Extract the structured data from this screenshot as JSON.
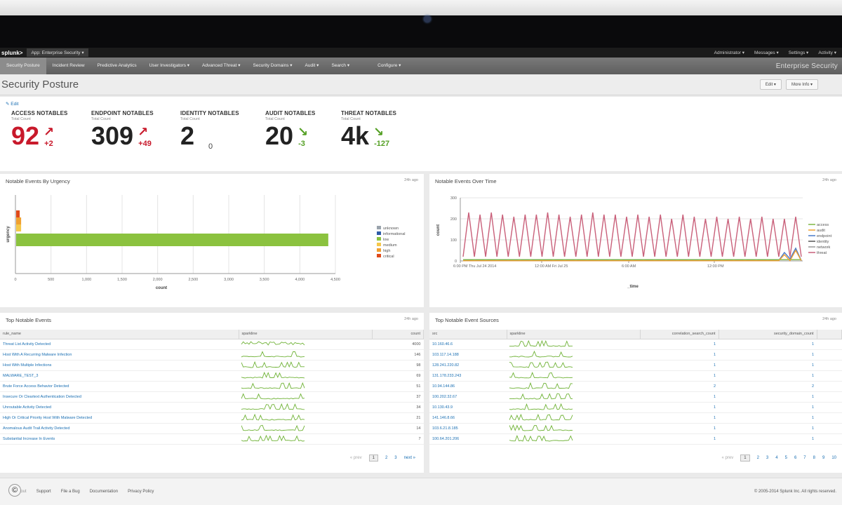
{
  "app": {
    "logo": "splunk>",
    "app_switcher": "App: Enterprise Security",
    "top_links": [
      "Administrator",
      "Messages",
      "Settings",
      "Activity"
    ]
  },
  "nav": {
    "items": [
      "Security Posture",
      "Incident Review",
      "Predictive Analytics",
      "User Investigators",
      "Advanced Threat",
      "Security Domains",
      "Audit",
      "Search",
      "Configure"
    ],
    "brand": "Enterprise Security"
  },
  "header": {
    "title": "Security Posture",
    "edit_btn": "Edit",
    "more_btn": "More Info"
  },
  "kpis": {
    "edit": "Edit",
    "items": [
      {
        "label": "ACCESS NOTABLES",
        "sub": "Total Count",
        "value": "92",
        "arrow": "↗",
        "delta": "+2"
      },
      {
        "label": "ENDPOINT NOTABLES",
        "sub": "Total Count",
        "value": "309",
        "arrow": "↗",
        "delta": "+49"
      },
      {
        "label": "IDENTITY NOTABLES",
        "sub": "Total Count",
        "value": "2",
        "arrow": "",
        "delta": "0"
      },
      {
        "label": "AUDIT NOTABLES",
        "sub": "Total Count",
        "value": "20",
        "arrow": "↘",
        "delta": "-3"
      },
      {
        "label": "THREAT NOTABLES",
        "sub": "Total Count",
        "value": "4k",
        "arrow": "↘",
        "delta": "-127"
      }
    ]
  },
  "panels": {
    "urgency_title": "Notable Events By Urgency",
    "over_time_title": "Notable Events Over Time",
    "top_events_title": "Top Notable Events",
    "top_sources_title": "Top Notable Event Sources",
    "link": "24h ago"
  },
  "chart_data": [
    {
      "type": "bar",
      "orientation": "horizontal",
      "stacked": true,
      "title": "Notable Events By Urgency",
      "xlabel": "count",
      "ylabel": "urgency",
      "xlim": [
        0,
        4500
      ],
      "xticks": [
        "0",
        "500",
        "1,000",
        "1,500",
        "2,000",
        "2,500",
        "3,000",
        "3,500",
        "4,000",
        "4,500"
      ],
      "legend": [
        "unknown",
        "informational",
        "low",
        "medium",
        "high",
        "critical"
      ],
      "legend_position": "right",
      "colors": {
        "unknown": "#9aa3ad",
        "informational": "#2e5ca8",
        "low": "#8bc23f",
        "medium": "#f5c84a",
        "high": "#f0a030",
        "critical": "#e04a1a"
      },
      "bars": [
        {
          "category": "critical",
          "value": 60
        },
        {
          "category": "high",
          "value": 80
        },
        {
          "category": "medium",
          "value": 80
        },
        {
          "category": "low",
          "value": 4400
        }
      ],
      "grid": true
    },
    {
      "type": "line",
      "title": "Notable Events Over Time",
      "xlabel": "_time",
      "ylabel": "count",
      "ylim": [
        0,
        300
      ],
      "yticks": [
        "0",
        "100",
        "200",
        "300"
      ],
      "xticks": [
        "6:00 PM Thu Jul 24 2014",
        "12:00 AM Fri Jul 25",
        "6:00 AM",
        "12:00 PM"
      ],
      "legend": [
        "access",
        "audit",
        "endpoint",
        "identity",
        "network",
        "threat"
      ],
      "legend_position": "right",
      "series": [
        {
          "name": "threat",
          "color": "#c9607a",
          "values": [
            20,
            230,
            20,
            220,
            20,
            230,
            20,
            220,
            20,
            210,
            20,
            220,
            20,
            220,
            20,
            230,
            20,
            220,
            20,
            210,
            20,
            220,
            20,
            230,
            20,
            220,
            20,
            220,
            20,
            210,
            20,
            220,
            20,
            210,
            20,
            220,
            20,
            200,
            20,
            220,
            20,
            210,
            20,
            200,
            20,
            210,
            20,
            200,
            20,
            210,
            20,
            200,
            20,
            210,
            20,
            200,
            20,
            200,
            20,
            210,
            20
          ]
        },
        {
          "name": "endpoint",
          "color": "#4a7ac8",
          "values": [
            2,
            4,
            2,
            4,
            2,
            4,
            2,
            4,
            2,
            4,
            2,
            4,
            2,
            4,
            2,
            4,
            2,
            4,
            2,
            4,
            2,
            4,
            2,
            4,
            2,
            4,
            2,
            4,
            2,
            4,
            2,
            4,
            2,
            4,
            2,
            4,
            2,
            4,
            2,
            4,
            2,
            4,
            2,
            4,
            2,
            4,
            2,
            4,
            2,
            4,
            2,
            4,
            2,
            4,
            2,
            4,
            2,
            40,
            10,
            60,
            2
          ]
        },
        {
          "name": "access",
          "color": "#7fb744",
          "values": [
            6,
            6,
            6,
            6,
            6,
            6,
            6,
            6,
            6,
            6,
            6,
            6,
            6,
            6,
            6,
            6,
            6,
            6,
            6,
            6,
            6,
            6,
            6,
            6,
            6,
            6,
            6,
            6,
            6,
            6,
            6,
            6,
            6,
            6,
            6,
            6,
            6,
            6,
            6,
            6,
            6,
            6,
            6,
            6,
            6,
            6,
            6,
            6,
            6,
            6,
            6,
            6,
            6,
            6,
            6,
            6,
            6,
            6,
            6,
            6,
            6
          ]
        },
        {
          "name": "audit",
          "color": "#f0a030",
          "values": [
            1,
            1,
            1,
            1,
            1,
            1,
            1,
            1,
            1,
            1,
            1,
            1,
            1,
            1,
            1,
            1,
            1,
            1,
            1,
            1,
            1,
            1,
            1,
            1,
            1,
            1,
            1,
            1,
            1,
            1,
            1,
            1,
            1,
            1,
            1,
            1,
            1,
            1,
            1,
            1,
            1,
            1,
            1,
            1,
            1,
            1,
            1,
            1,
            1,
            1,
            1,
            1,
            1,
            1,
            1,
            1,
            1,
            30,
            1,
            50,
            1
          ]
        }
      ],
      "grid": true
    }
  ],
  "top_events": {
    "columns": [
      "rule_name",
      "sparkline",
      "count"
    ],
    "rows": [
      {
        "name": "Threat List Activity Detected",
        "count": "4000"
      },
      {
        "name": "Host With A Recurring Malware Infection",
        "count": "146"
      },
      {
        "name": "Host With Multiple Infections",
        "count": "98"
      },
      {
        "name": "MALWARE_TEST_3",
        "count": "69"
      },
      {
        "name": "Brute Force Access Behavior Detected",
        "count": "51"
      },
      {
        "name": "Insecure Or Cleartext Authentication Detected",
        "count": "37"
      },
      {
        "name": "Unroutable Activity Detected",
        "count": "34"
      },
      {
        "name": "High Or Critical Priority Host With Malware Detected",
        "count": "21"
      },
      {
        "name": "Anomalous Audit Trail Activity Detected",
        "count": "14"
      },
      {
        "name": "Substantial Increase In Events",
        "count": "7"
      }
    ],
    "pager": [
      "« prev",
      "1",
      "2",
      "3",
      "next »"
    ]
  },
  "top_sources": {
    "columns": [
      "src",
      "sparkline",
      "correlation_search_count",
      "security_domain_count",
      ""
    ],
    "rows": [
      {
        "src": "10.160.46.6",
        "csc": "1",
        "sdc": "1"
      },
      {
        "src": "103.117.14.188",
        "csc": "1",
        "sdc": "1"
      },
      {
        "src": "128.241.220.82",
        "csc": "1",
        "sdc": "1"
      },
      {
        "src": "131.178.233.243",
        "csc": "1",
        "sdc": "1"
      },
      {
        "src": "10.94.144.86",
        "csc": "2",
        "sdc": "2"
      },
      {
        "src": "100.202.32.67",
        "csc": "1",
        "sdc": "1"
      },
      {
        "src": "10.130.43.9",
        "csc": "1",
        "sdc": "1"
      },
      {
        "src": "141.146.8.66",
        "csc": "1",
        "sdc": "1"
      },
      {
        "src": "103.6.21.8.185",
        "csc": "1",
        "sdc": "1"
      },
      {
        "src": "100.64.201.206",
        "csc": "1",
        "sdc": "1"
      }
    ],
    "pager": [
      "« prev",
      "1",
      "2",
      "3",
      "4",
      "5",
      "6",
      "7",
      "8",
      "9",
      "10"
    ]
  },
  "footer": {
    "links": [
      "About",
      "Support",
      "File a Bug",
      "Documentation",
      "Privacy Policy"
    ],
    "copyright": "© 2005-2014 Splunk Inc. All rights reserved."
  },
  "watermark": "©"
}
